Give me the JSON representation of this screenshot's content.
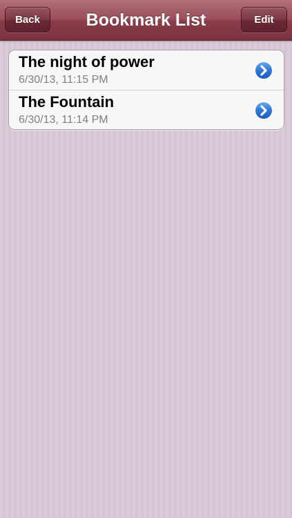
{
  "navbar": {
    "title": "Bookmark List",
    "back_label": "Back",
    "edit_label": "Edit"
  },
  "bookmarks": [
    {
      "title": "The night of power",
      "date": "6/30/13, 11:15 PM"
    },
    {
      "title": "The Fountain",
      "date": "6/30/13, 11:14 PM"
    }
  ],
  "icons": {
    "disclosure": "chevron-right-circle-icon"
  },
  "colors": {
    "navbar": "#8a3e4a",
    "background": "#d8cbd6",
    "disclosure": "#2f77d6"
  }
}
